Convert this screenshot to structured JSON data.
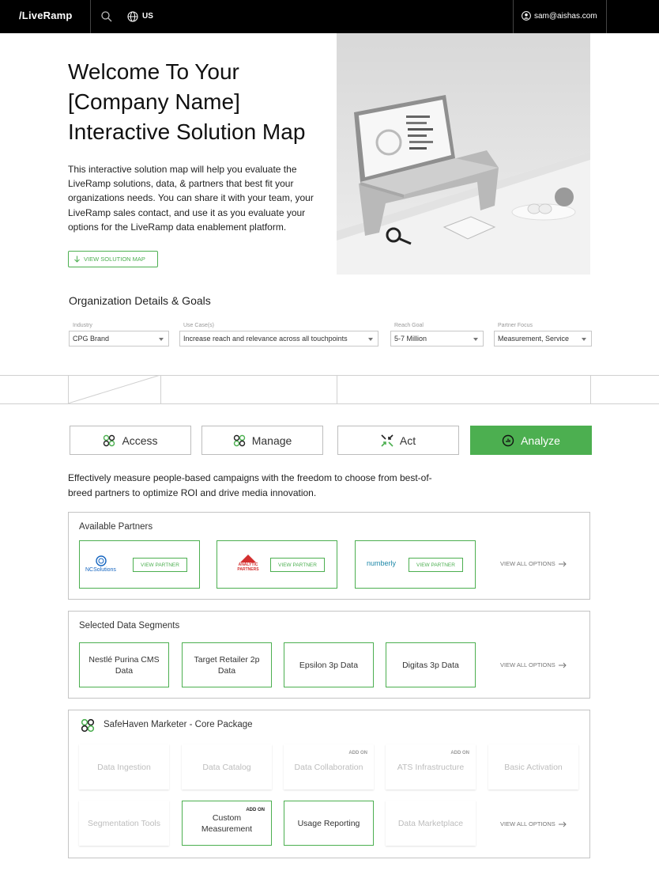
{
  "header": {
    "logo": "/LiveRamp",
    "region": "US",
    "user_email": "sam@aishas.com"
  },
  "hero": {
    "title": "Welcome To Your [Company Name] Interactive Solution Map",
    "description": "This interactive solution map will help you evaluate the LiveRamp solutions, data, & partners that best fit your organizations needs. You can share it with your team, your LiveRamp sales contact, and use it as you evaluate your options for the LiveRamp data enablement platform.",
    "cta_label": "VIEW SOLUTION MAP"
  },
  "org": {
    "title": "Organization Details & Goals",
    "fields": [
      {
        "label": "Industry",
        "value": "CPG Brand"
      },
      {
        "label": "Use Case(s)",
        "value": "Increase reach and relevance across all touchpoints"
      },
      {
        "label": "Reach Goal",
        "value": "5-7 Million"
      },
      {
        "label": "Partner Focus",
        "value": "Measurement, Service"
      }
    ]
  },
  "tabs": [
    {
      "label": "Access",
      "active": false
    },
    {
      "label": "Manage",
      "active": false
    },
    {
      "label": "Act",
      "active": false
    },
    {
      "label": "Analyze",
      "active": true
    }
  ],
  "section_description": "Effectively measure people-based campaigns with the freedom to choose from best-of-breed partners to optimize ROI and drive media innovation.",
  "partners": {
    "title": "Available Partners",
    "items": [
      {
        "name": "NCSolutions",
        "button": "VIEW PARTNER"
      },
      {
        "name": "ANALYTIC PARTNERS",
        "button": "VIEW PARTNER"
      },
      {
        "name": "numberly",
        "button": "VIEW PARTNER"
      }
    ],
    "view_all": "VIEW ALL OPTIONS"
  },
  "segments": {
    "title": "Selected Data Segments",
    "items": [
      "Nestlé Purina CMS Data",
      "Target Retailer 2p Data",
      "Epsilon 3p Data",
      "Digitas 3p Data"
    ],
    "view_all": "VIEW ALL OPTIONS"
  },
  "package": {
    "title": "SafeHaven Marketer - Core Package",
    "addon_label": "ADD ON",
    "items": [
      {
        "label": "Data Ingestion",
        "addon": false,
        "selected": false
      },
      {
        "label": "Data Catalog",
        "addon": false,
        "selected": false
      },
      {
        "label": "Data Collaboration",
        "addon": true,
        "selected": false
      },
      {
        "label": "ATS Infrastructure",
        "addon": true,
        "selected": false
      },
      {
        "label": "Basic Activation",
        "addon": false,
        "selected": false
      },
      {
        "label": "Segmentation Tools",
        "addon": false,
        "selected": false
      },
      {
        "label": "Custom Measurement",
        "addon": true,
        "selected": true
      },
      {
        "label": "Usage Reporting",
        "addon": false,
        "selected": true
      },
      {
        "label": "Data Marketplace",
        "addon": false,
        "selected": false
      }
    ],
    "view_all": "VIEW ALL OPTIONS"
  },
  "colors": {
    "accent": "#4caf50",
    "topbar": "#000000"
  }
}
